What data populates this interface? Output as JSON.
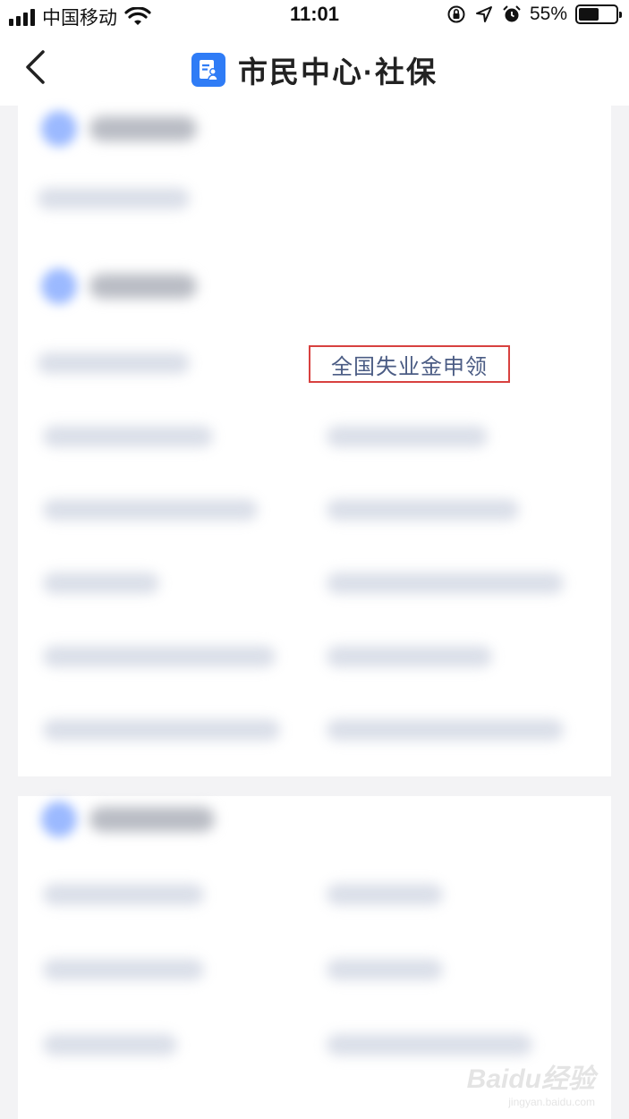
{
  "status_bar": {
    "carrier": "中国移动",
    "time": "11:01",
    "battery_percent": "55%",
    "battery_level": 0.55,
    "icons": [
      "signal-icon",
      "wifi-icon",
      "rotation-lock-icon",
      "location-icon",
      "alarm-icon",
      "battery-icon"
    ]
  },
  "nav": {
    "title": "市民中心·社保",
    "back_icon": "chevron-left-icon",
    "app_icon": "document-person-icon",
    "accent_color": "#2f7cf6"
  },
  "content": {
    "highlighted_item": "全国失业金申领",
    "highlight_color": "#d8413f"
  },
  "watermark": {
    "brand": "Baidu经验",
    "sub": "jingyan.baidu.com"
  }
}
